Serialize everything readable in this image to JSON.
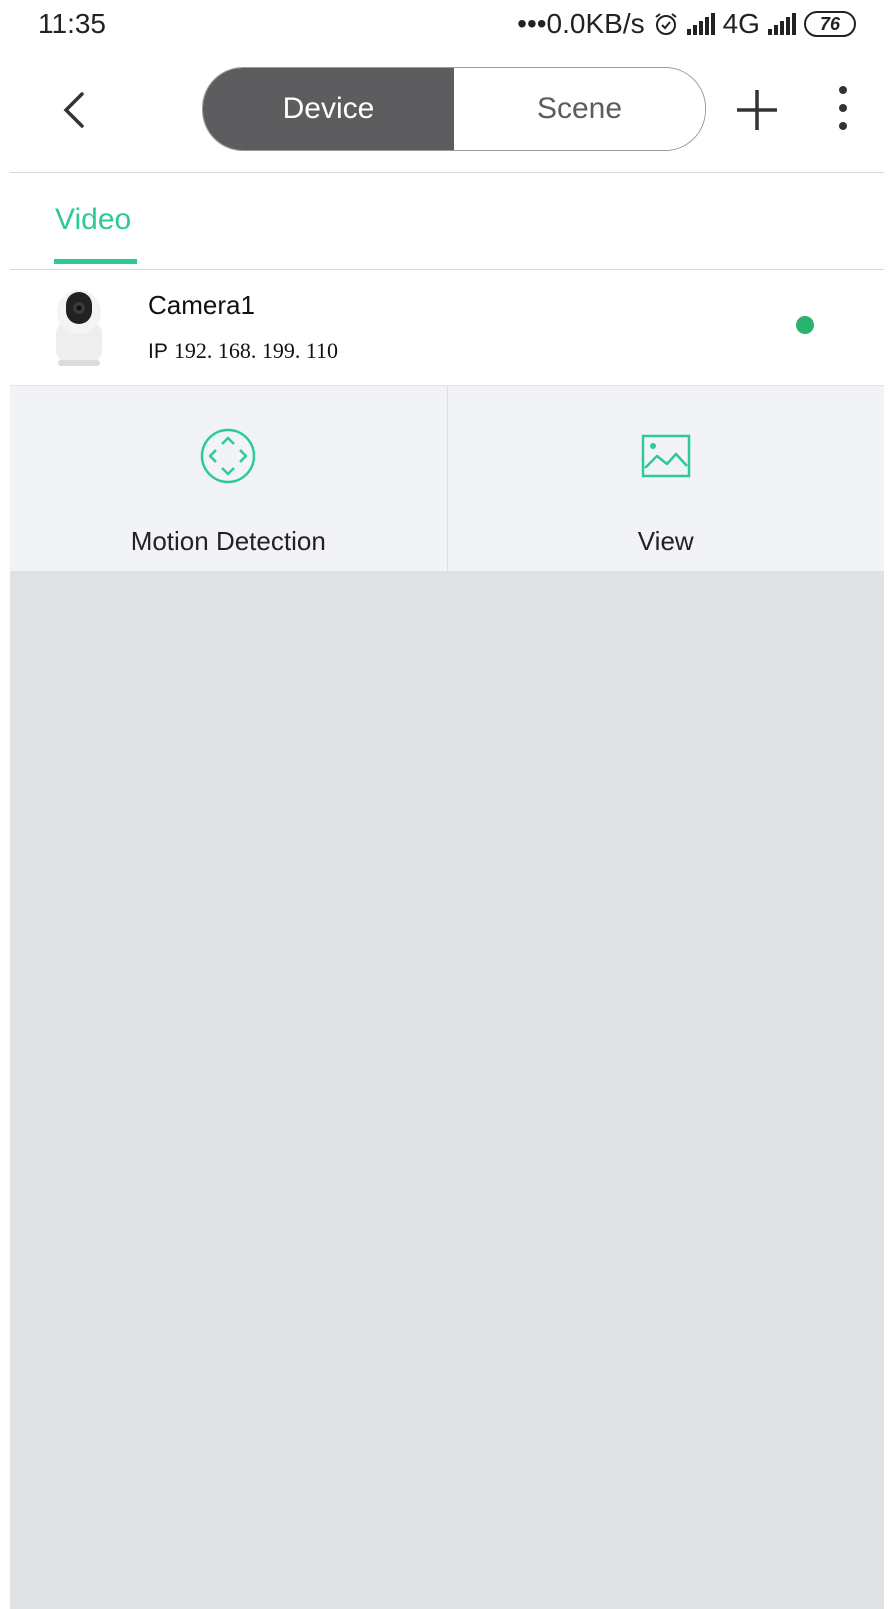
{
  "status_bar": {
    "time": "11:35",
    "net_speed": "•••0.0KB/s",
    "network": "4G",
    "battery": "76"
  },
  "nav": {
    "segments": {
      "device": "Device",
      "scene": "Scene"
    },
    "active_segment": "Device"
  },
  "tabs": {
    "video": "Video"
  },
  "device": {
    "name": "Camera1",
    "ip_prefix": "IP",
    "ip": "192. 168. 199. 110",
    "status_color": "#28b46f"
  },
  "actions": {
    "motion_detection": "Motion Detection",
    "view": "View"
  },
  "colors": {
    "accent": "#2ec99a",
    "segment_active": "#5d5d5f"
  },
  "icons": [
    "back-icon",
    "plus-icon",
    "more-vert-icon",
    "camera-icon",
    "motion-detection-icon",
    "image-icon",
    "alarm-icon",
    "signal-icon"
  ]
}
